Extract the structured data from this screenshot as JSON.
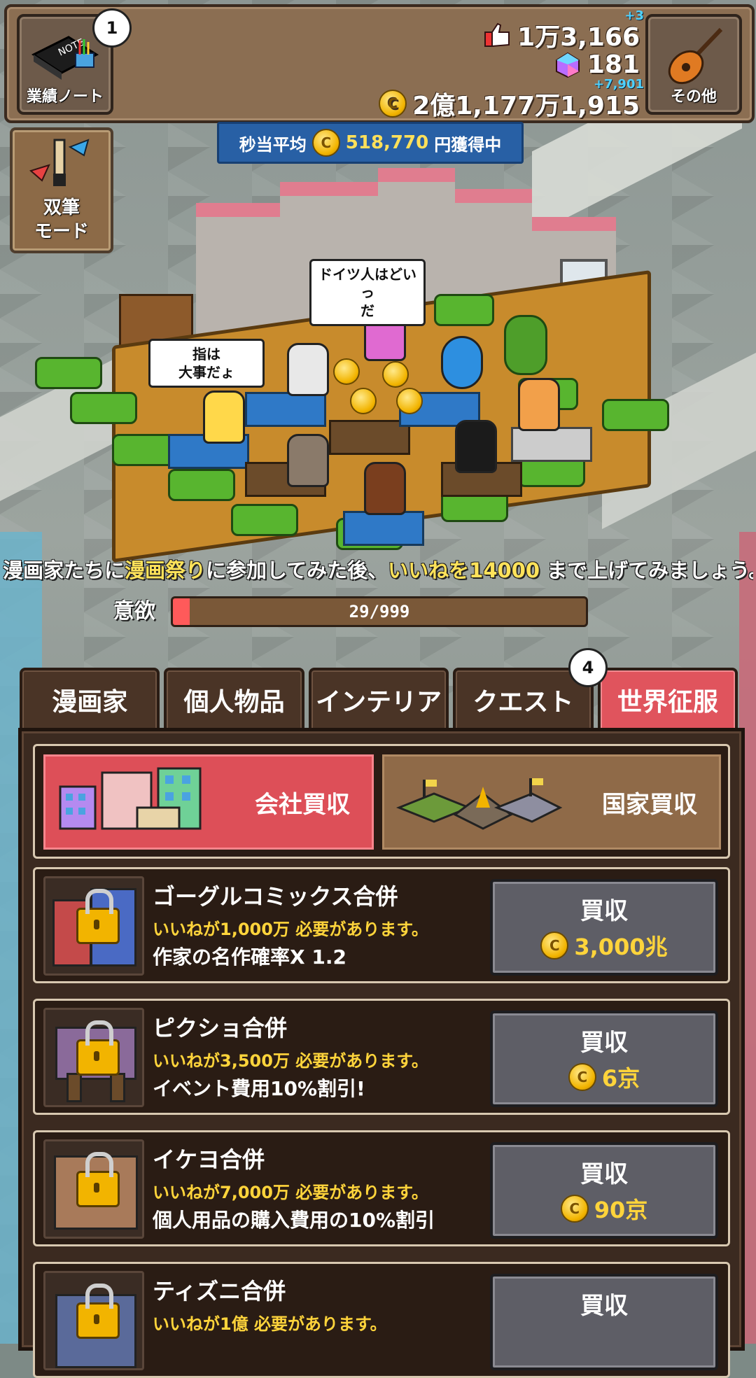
{
  "hud": {
    "notes_label": "業績ノート",
    "notes_badge": "1",
    "likes": "1万3,166",
    "likes_delta": "+3",
    "gems": "181",
    "money": "2億1,177万1,915",
    "money_delta": "+7,901",
    "other_label": "その他"
  },
  "income": {
    "prefix": "秒当平均",
    "amount": "518,770",
    "suffix": "円獲得中"
  },
  "dual_mode": {
    "label": "双筆\nモード"
  },
  "scene": {
    "bubble1": "ドイツ人はどいっ\nだ",
    "bubble2": "指は\n大事だょ"
  },
  "mission": {
    "p1": "漫画家たちに",
    "h1": "漫画祭り",
    "p2": "に参加してみた後、",
    "h2": "いいねを14000",
    "p3": " まで上げてみましょう。"
  },
  "motivation": {
    "label": "意欲",
    "value": "29/999",
    "current": 29,
    "max": 999
  },
  "tabs": {
    "t1": "漫画家",
    "t2": "個人物品",
    "t3": "インテリア",
    "t4": "クエスト",
    "t5": "世界征服",
    "quest_badge": "4"
  },
  "subtabs": {
    "company": "会社買収",
    "nation": "国家買収"
  },
  "rows": [
    {
      "title": "ゴーグルコミックス合併",
      "req": "いいねが1,000万 必要があります。",
      "effect": "作家の名作確率X 1.2",
      "buy": "買収",
      "price": "3,000兆"
    },
    {
      "title": "ピクショ合併",
      "req": "いいねが3,500万 必要があります。",
      "effect": "イベント費用10%割引!",
      "buy": "買収",
      "price": "6京"
    },
    {
      "title": "イケヨ合併",
      "req": "いいねが7,000万 必要があります。",
      "effect": "個人用品の購入費用の10%割引",
      "buy": "買収",
      "price": "90京"
    },
    {
      "title": "ティズニ合併",
      "req": "いいねが1億 必要があります。",
      "effect": "",
      "buy": "買収",
      "price": ""
    }
  ],
  "colors": {
    "active_tab": "#e0545d",
    "panel": "#3b2a20",
    "price": "#ffd43b",
    "income_bar": "#2860a5"
  },
  "icons": [
    "notebook-icon",
    "thumbs-up-icon",
    "gem-icon",
    "coin-icon",
    "guitar-icon",
    "brush-icon",
    "lock-icon"
  ]
}
